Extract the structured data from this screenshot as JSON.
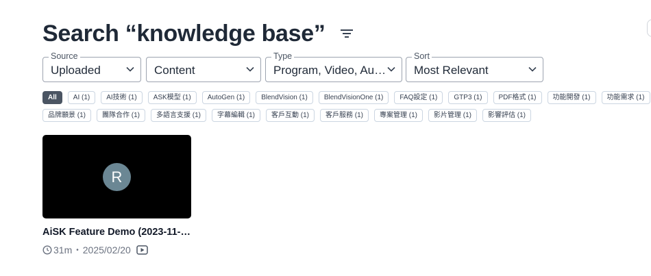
{
  "header": {
    "title": "Search “knowledge base”",
    "filter_icon": "filter-lines-icon"
  },
  "filters": {
    "source": {
      "legend": "Source",
      "value": "Uploaded"
    },
    "content": {
      "legend": "",
      "value": "Content"
    },
    "type": {
      "legend": "Type",
      "value": "Program, Video, Au…"
    },
    "sort": {
      "legend": "Sort",
      "value": "Most Relevant"
    }
  },
  "tags": {
    "row1": [
      "All",
      "AI (1)",
      "AI技術 (1)",
      "ASK模型 (1)",
      "AutoGen (1)",
      "BlendVision (1)",
      "BlendVisionOne (1)",
      "FAQ設定 (1)",
      "GTP3 (1)",
      "PDF格式 (1)",
      "功能開發 (1)",
      "功能需求 (1)"
    ],
    "row2": [
      "品牌願景 (1)",
      "團隊合作 (1)",
      "多語言支援 (1)",
      "字幕編輯 (1)",
      "客戶互動 (1)",
      "客戶服務 (1)",
      "專案管理 (1)",
      "影片管理 (1)",
      "影響評估 (1)"
    ],
    "active": "All"
  },
  "results": [
    {
      "title": "AiSK Feature Demo (2023-11-…",
      "avatar_letter": "R",
      "duration": "31m",
      "separator": "•",
      "date": "2025/02/20",
      "icons": [
        "clock-icon",
        "play-icon"
      ]
    }
  ],
  "colors": {
    "active_tag": "#4b5563",
    "avatar": "#6b8794",
    "thumbnail": "#000000"
  }
}
